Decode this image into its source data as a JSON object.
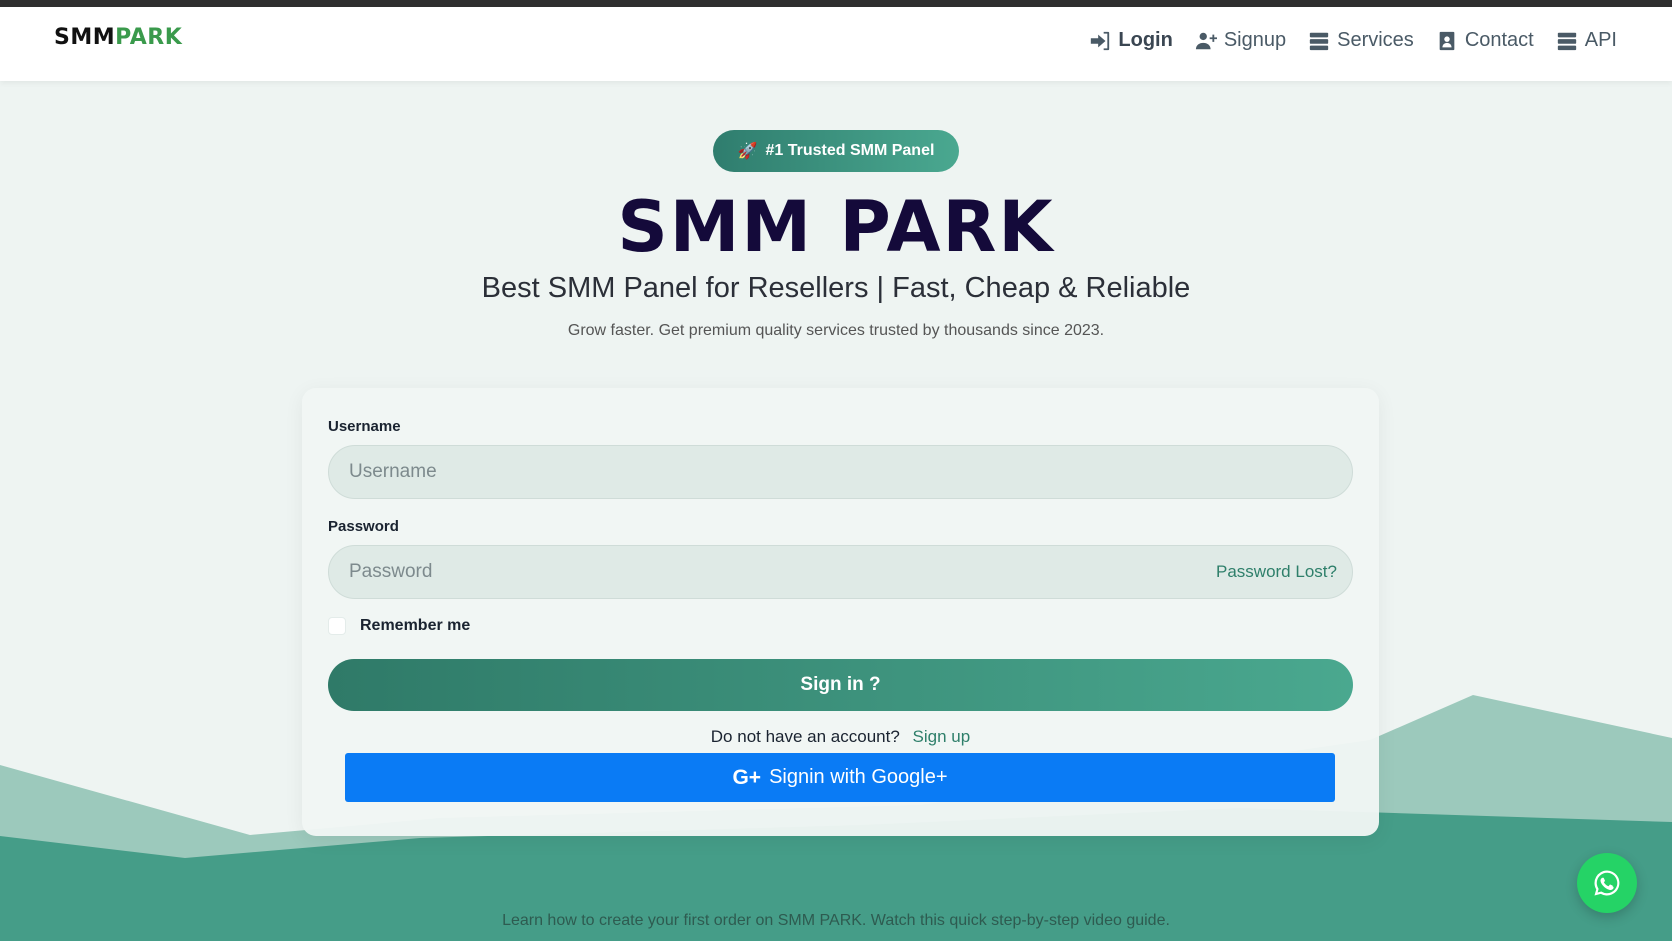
{
  "brand": {
    "part1": "SMM",
    "part2": "PARK",
    "accent": "#3a9a4c"
  },
  "nav": {
    "items": [
      {
        "label": "Login",
        "icon": "sign-in-icon"
      },
      {
        "label": "Signup",
        "icon": "user-plus-icon"
      },
      {
        "label": "Services",
        "icon": "server-icon"
      },
      {
        "label": "Contact",
        "icon": "contact-card-icon"
      },
      {
        "label": "API",
        "icon": "server-icon"
      }
    ]
  },
  "hero": {
    "badge_icon": "🚀",
    "badge": "#1 Trusted SMM Panel",
    "title": "SMM PARK",
    "subtitle": "Best SMM Panel for Resellers | Fast, Cheap & Reliable",
    "description": "Grow faster. Get premium quality services trusted by thousands since 2023."
  },
  "form": {
    "username_label": "Username",
    "username_placeholder": "Username",
    "username_value": "",
    "password_label": "Password",
    "password_placeholder": "Password",
    "password_value": "",
    "password_lost": "Password Lost?",
    "remember": "Remember me",
    "signin": "Sign in ?",
    "no_account": "Do not have an account?",
    "signup_link": "Sign up",
    "google_icon": "G+",
    "google": "Signin with Google+"
  },
  "footer": {
    "guide": "Learn how to create your first order on SMM PARK. Watch this quick step-by-step video guide."
  },
  "colors": {
    "primary_green": "#3a8f7a",
    "google_blue": "#0a7bf5",
    "whatsapp_green": "#25d366",
    "title_navy": "#140a3a"
  }
}
